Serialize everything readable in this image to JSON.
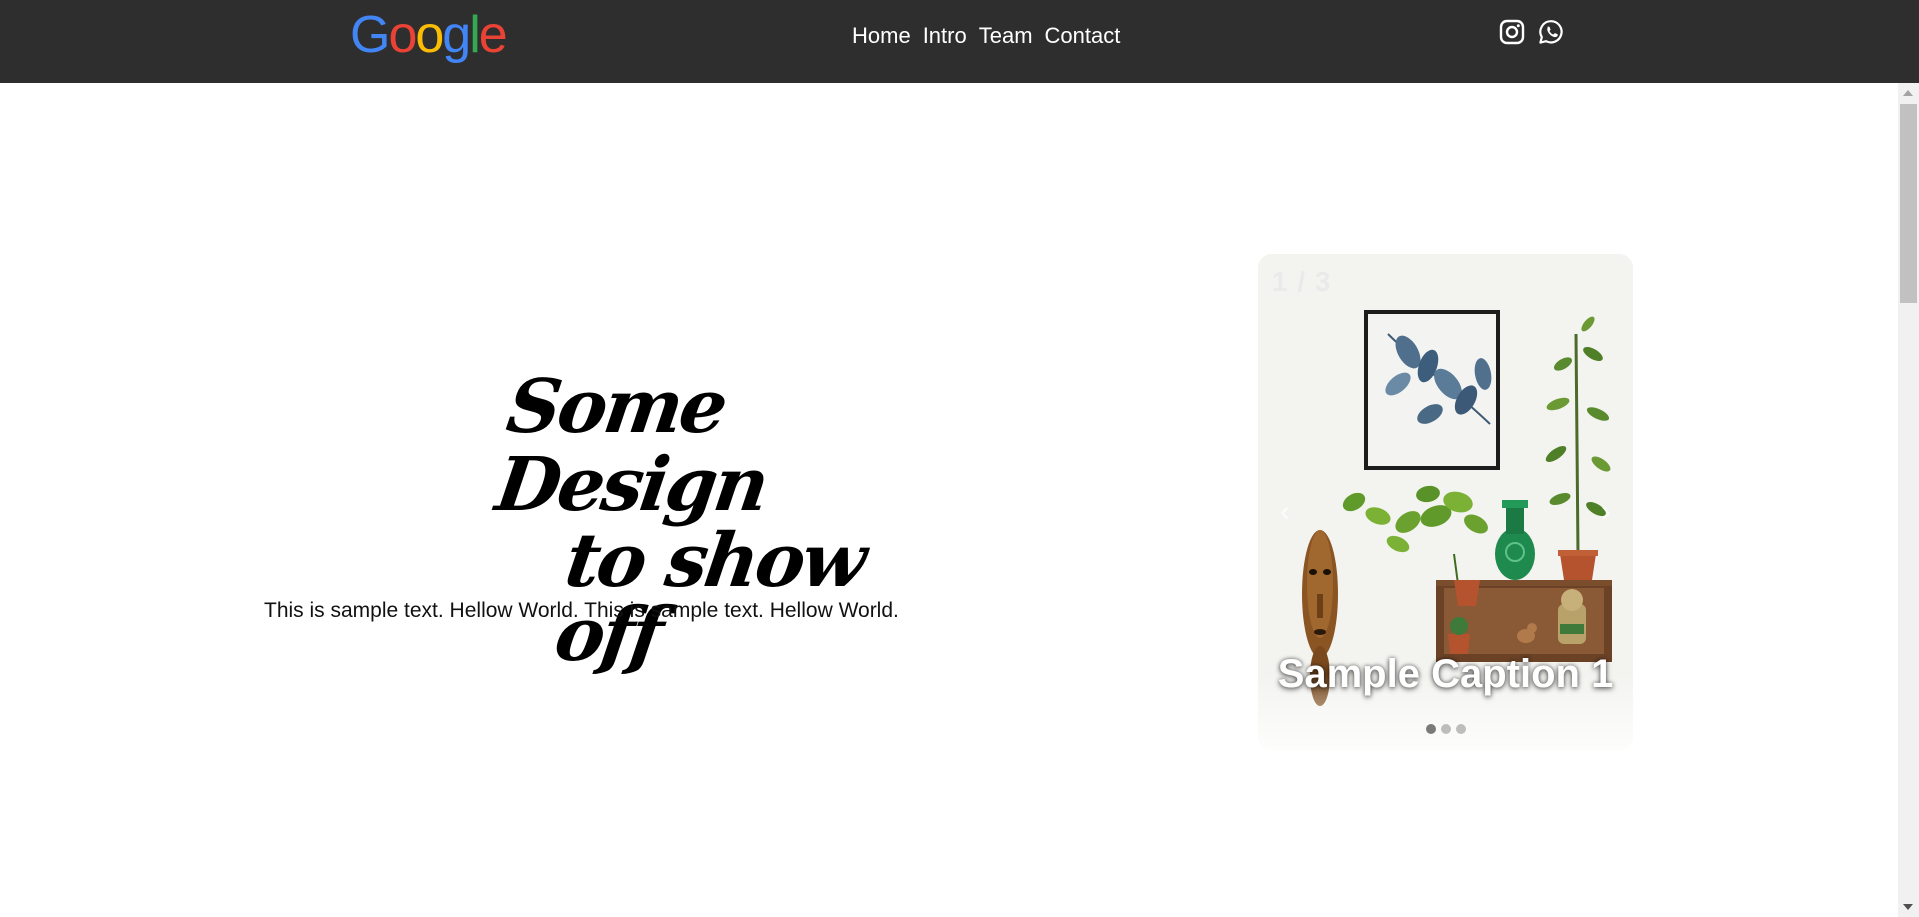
{
  "header": {
    "logo": {
      "text": "Google",
      "letters": [
        {
          "char": "G",
          "color": "#4285F4"
        },
        {
          "char": "o",
          "color": "#EA4335"
        },
        {
          "char": "o",
          "color": "#FBBC05"
        },
        {
          "char": "g",
          "color": "#4285F4"
        },
        {
          "char": "l",
          "color": "#34A853"
        },
        {
          "char": "e",
          "color": "#EA4335"
        }
      ]
    },
    "nav": [
      {
        "label": "Home"
      },
      {
        "label": "Intro"
      },
      {
        "label": "Team"
      },
      {
        "label": "Contact"
      }
    ],
    "social": [
      {
        "icon": "instagram-icon"
      },
      {
        "icon": "whatsapp-icon"
      }
    ],
    "background": "#2e2e2e"
  },
  "hero": {
    "title_line1": "Some Design",
    "title_line2": "to show off",
    "text": "This is sample text. Hellow World. This is sample text. Hellow World."
  },
  "carousel": {
    "counter": "1 / 3",
    "caption": "Sample Caption 1",
    "prev_icon": "chevron-left-icon",
    "next_icon": "chevron-right-icon",
    "slide_count": 3,
    "active_index": 0
  }
}
